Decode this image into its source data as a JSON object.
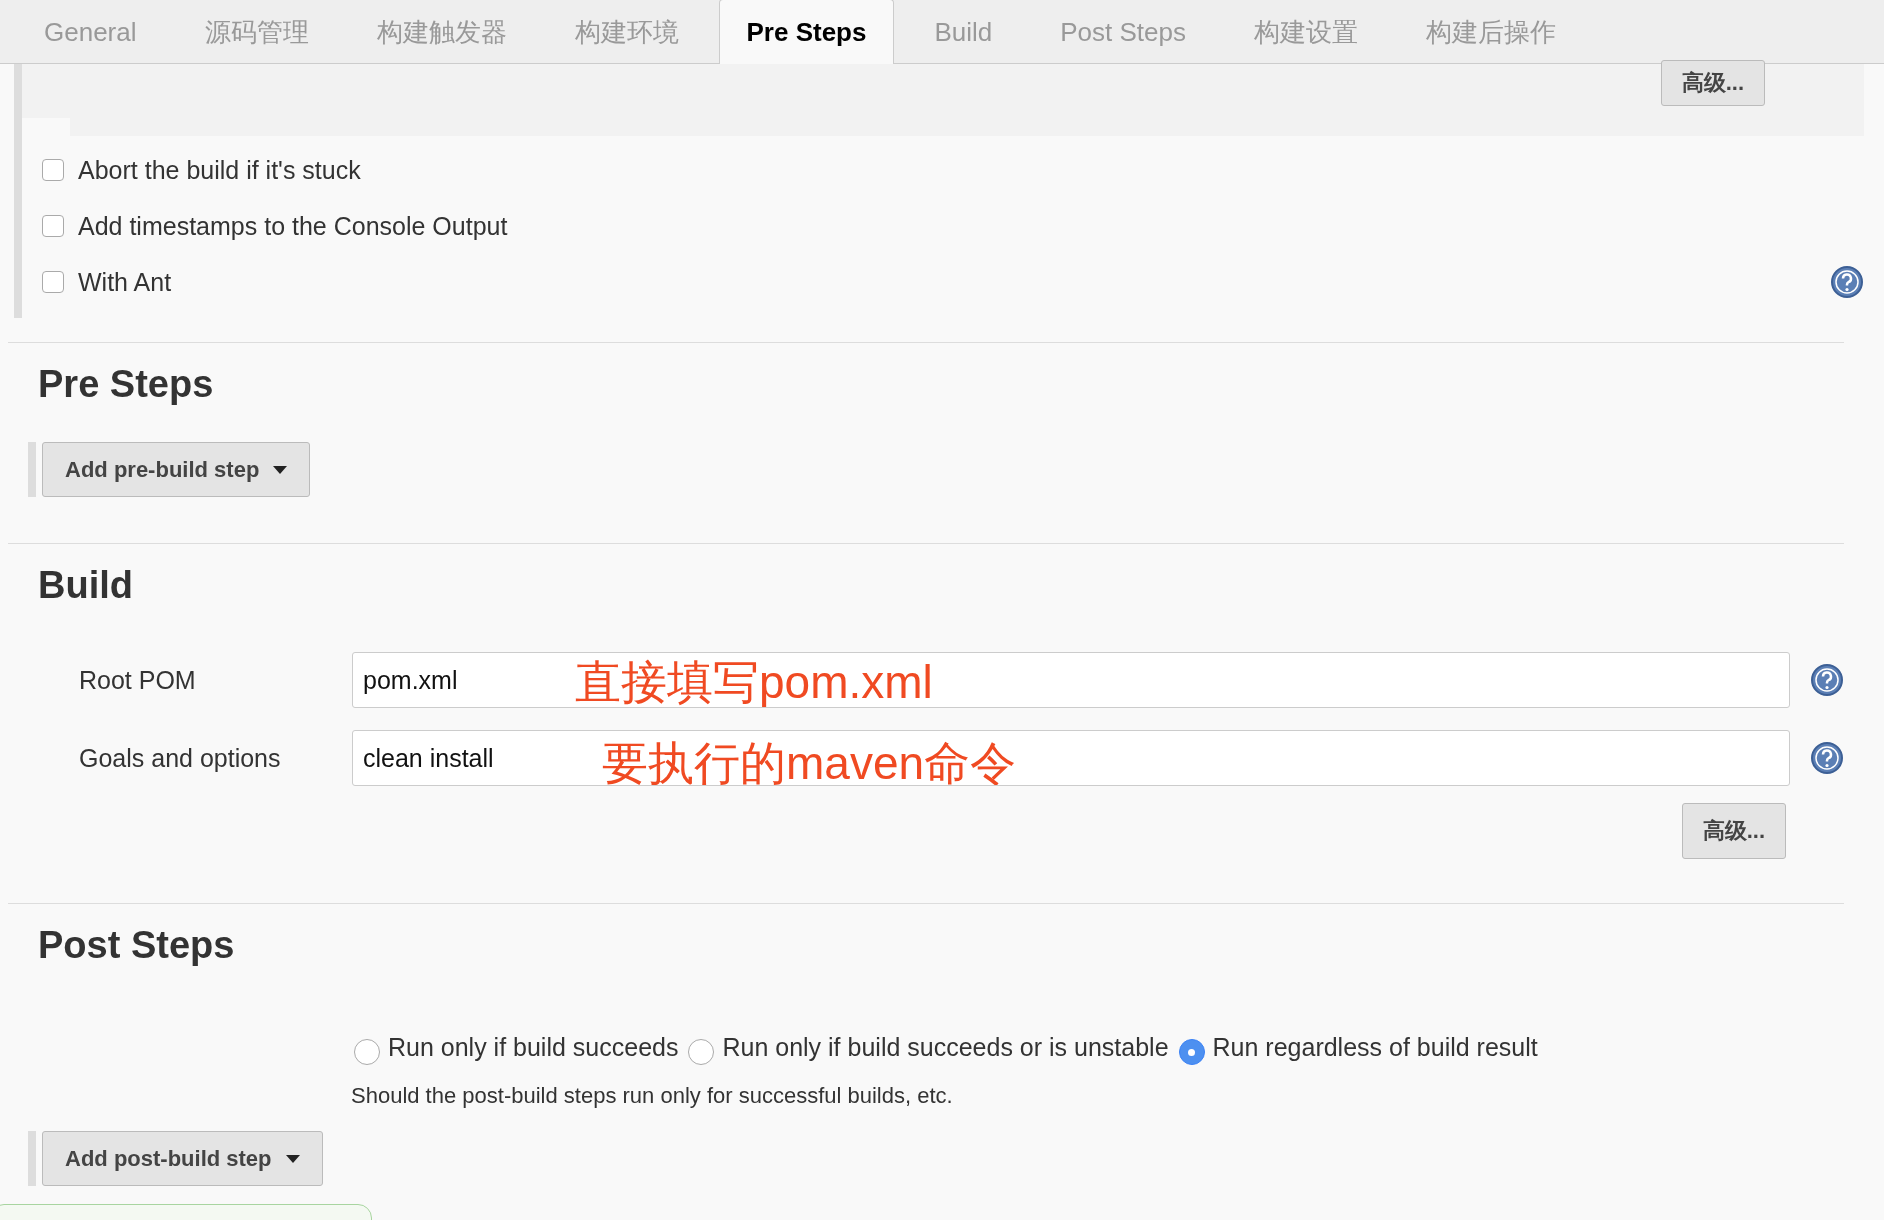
{
  "tabs": [
    {
      "label": "General",
      "selected": false
    },
    {
      "label": "源码管理",
      "selected": false
    },
    {
      "label": "构建触发器",
      "selected": false
    },
    {
      "label": "构建环境",
      "selected": false
    },
    {
      "label": "Pre Steps",
      "selected": true
    },
    {
      "label": "Build",
      "selected": false
    },
    {
      "label": "Post Steps",
      "selected": false
    },
    {
      "label": "构建设置",
      "selected": false
    },
    {
      "label": "构建后操作",
      "selected": false
    }
  ],
  "environment": {
    "advanced_button": "高级...",
    "options": [
      {
        "label": "Abort the build if it's stuck",
        "checked": false
      },
      {
        "label": "Add timestamps to the Console Output",
        "checked": false
      },
      {
        "label": "With Ant",
        "checked": false
      }
    ]
  },
  "pre_steps": {
    "heading": "Pre Steps",
    "button": "Add pre-build step"
  },
  "build": {
    "heading": "Build",
    "fields": [
      {
        "label": "Root POM",
        "value": "pom.xml",
        "annotation": "直接填写pom.xml"
      },
      {
        "label": "Goals and options",
        "value": "clean install",
        "annotation": "要执行的maven命令"
      }
    ],
    "advanced_button": "高级..."
  },
  "post_steps": {
    "heading": "Post Steps",
    "options": [
      {
        "label": "Run only if build succeeds",
        "selected": false
      },
      {
        "label": "Run only if build succeeds or is unstable",
        "selected": false
      },
      {
        "label": "Run regardless of build result",
        "selected": true
      }
    ],
    "description": "Should the post-build steps run only for successful builds, etc.",
    "button": "Add post-build step"
  }
}
